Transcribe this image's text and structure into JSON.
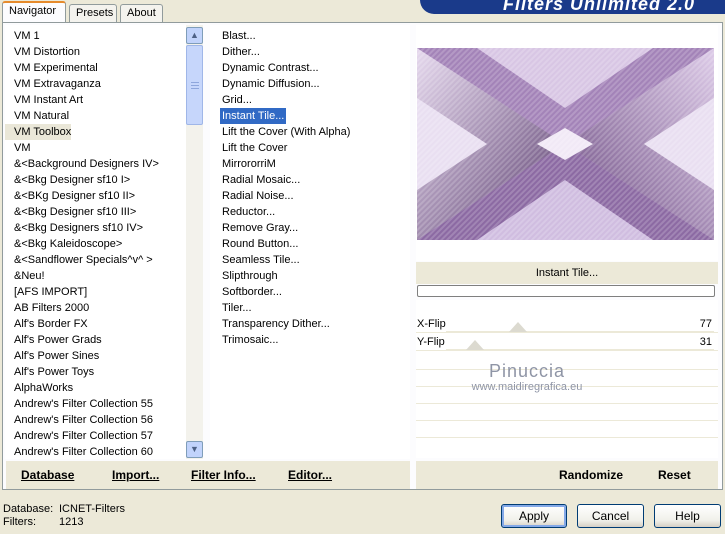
{
  "tabs": [
    {
      "label": "Navigator",
      "active": true
    },
    {
      "label": "Presets",
      "active": false
    },
    {
      "label": "About",
      "active": false
    }
  ],
  "banner": {
    "title": "Filters Unlimited 2.0"
  },
  "categories": {
    "items": [
      "VM 1",
      "VM Distortion",
      "VM Experimental",
      "VM Extravaganza",
      "VM Instant Art",
      "VM Natural",
      "VM Toolbox",
      "VM",
      "&<Background Designers IV>",
      "&<Bkg Designer sf10 I>",
      "&<BKg Designer sf10 II>",
      "&<Bkg Designer sf10 III>",
      "&<Bkg Designers sf10 IV>",
      "&<Bkg Kaleidoscope>",
      "&<Sandflower Specials^v^ >",
      "&Neu!",
      "[AFS IMPORT]",
      "AB Filters 2000",
      "Alf's Border FX",
      "Alf's Power Grads",
      "Alf's Power Sines",
      "Alf's Power Toys",
      "AlphaWorks",
      "Andrew's Filter Collection 55",
      "Andrew's Filter Collection 56",
      "Andrew's Filter Collection 57",
      "Andrew's Filter Collection 60"
    ],
    "selected_index": 6
  },
  "filters": {
    "items": [
      "Blast...",
      "Dither...",
      "Dynamic Contrast...",
      "Dynamic Diffusion...",
      "Grid...",
      "Instant Tile...",
      "Lift the Cover (With Alpha)",
      "Lift the Cover",
      "MirrororriM",
      "Radial Mosaic...",
      "Radial Noise...",
      "Reductor...",
      "Remove Gray...",
      "Round Button...",
      "Seamless Tile...",
      "Slipthrough",
      "Softborder...",
      "Tiler...",
      "Transparency Dither...",
      "Trimosaic..."
    ],
    "selected_index": 5
  },
  "current_filter": {
    "name": "Instant Tile..."
  },
  "parameters": [
    {
      "label": "X-Flip",
      "value": "77",
      "level": 77
    },
    {
      "label": "Y-Flip",
      "value": "31",
      "level": 31
    }
  ],
  "watermark": {
    "line1": "Pinuccia",
    "line2": "www.maidiregrafica.eu"
  },
  "toolbar": {
    "database": "Database",
    "import": "Import...",
    "filter_info": "Filter Info...",
    "editor": "Editor...",
    "randomize": "Randomize",
    "reset": "Reset"
  },
  "status": {
    "database_label": "Database:",
    "database_value": "ICNET-Filters",
    "filters_label": "Filters:",
    "filters_value": "1213"
  },
  "buttons": {
    "apply": "Apply",
    "cancel": "Cancel",
    "help": "Help"
  },
  "colors": {
    "accent": "#316ac5",
    "preview_light": "#c9b3d9",
    "preview_dark": "#4a2f5c"
  }
}
